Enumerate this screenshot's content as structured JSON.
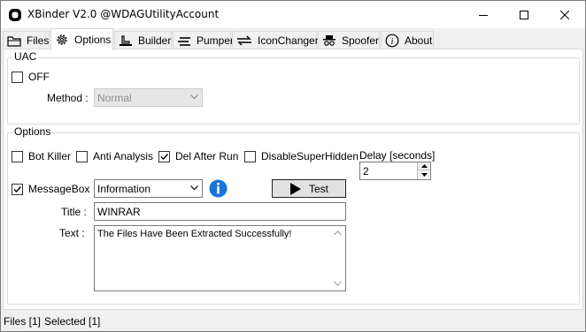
{
  "window": {
    "title": "XBinder V2.0 @WDAGUtilityAccount"
  },
  "tabs": [
    {
      "label": "Files",
      "icon": "folder-icon"
    },
    {
      "label": "Options",
      "icon": "gear-icon",
      "active": true
    },
    {
      "label": "Builder",
      "icon": "builder-icon"
    },
    {
      "label": "Pumper",
      "icon": "pumper-icon"
    },
    {
      "label": "IconChanger",
      "icon": "iconchanger-icon"
    },
    {
      "label": "Spoofer",
      "icon": "spoofer-icon"
    },
    {
      "label": "About",
      "icon": "info-icon"
    }
  ],
  "uac": {
    "legend": "UAC",
    "off_label": "OFF",
    "off_checked": false,
    "method_label": "Method :",
    "method_value": "Normal"
  },
  "options": {
    "legend": "Options",
    "bot_killer": {
      "label": "Bot Killer",
      "checked": false
    },
    "anti_analysis": {
      "label": "Anti Analysis",
      "checked": false
    },
    "del_after_run": {
      "label": "Del After Run",
      "checked": true
    },
    "disable_super_hidden": {
      "label": "DisableSuperHidden",
      "checked": false
    },
    "delay_label": "Delay [seconds]",
    "delay_value": "2",
    "messagebox": {
      "label": "MessageBox",
      "checked": true
    },
    "msg_type_value": "Information",
    "test_label": "Test",
    "title_label": "Title :",
    "title_value": "WINRAR",
    "text_label": "Text :",
    "text_value": "The Files Have Been Extracted Successfully!"
  },
  "status": {
    "files": "Files [1]",
    "selected": "Selected [1]"
  },
  "colors": {
    "info_blue": "#1a73d9",
    "border": "#7a7a7a"
  }
}
